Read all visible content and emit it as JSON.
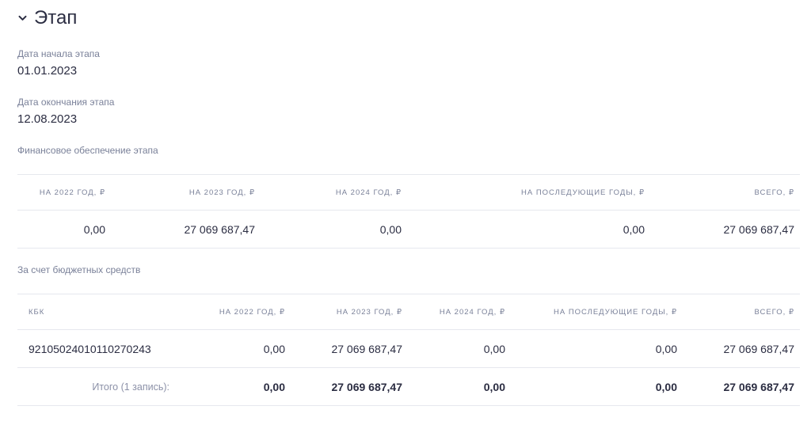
{
  "section": {
    "title": "Этап"
  },
  "fields": {
    "start_label": "Дата начала этапа",
    "start_value": "01.01.2023",
    "end_label": "Дата окончания этапа",
    "end_value": "12.08.2023"
  },
  "finance": {
    "label": "Финансовое обеспечение этапа",
    "headers": [
      "НА 2022 ГОД, ₽",
      "НА 2023 ГОД, ₽",
      "НА 2024 ГОД, ₽",
      "НА ПОСЛЕДУЮЩИЕ ГОДЫ, ₽",
      "ВСЕГО, ₽"
    ],
    "row": [
      "0,00",
      "27 069 687,47",
      "0,00",
      "0,00",
      "27 069 687,47"
    ]
  },
  "budget": {
    "label": "За счет бюджетных средств",
    "headers": [
      "КБК",
      "НА 2022 ГОД, ₽",
      "НА 2023 ГОД, ₽",
      "НА 2024 ГОД, ₽",
      "НА ПОСЛЕДУЮЩИЕ ГОДЫ, ₽",
      "ВСЕГО, ₽"
    ],
    "row": [
      "92105024010110270243",
      "0,00",
      "27 069 687,47",
      "0,00",
      "0,00",
      "27 069 687,47"
    ],
    "total_label": "Итого (1 запись):",
    "totals": [
      "0,00",
      "27 069 687,47",
      "0,00",
      "0,00",
      "27 069 687,47"
    ]
  },
  "colors": {
    "text": "#2b2d42",
    "muted": "#7a8199",
    "border": "#e6e8ee"
  },
  "icons": {
    "toggle": "chevron-down-icon"
  }
}
